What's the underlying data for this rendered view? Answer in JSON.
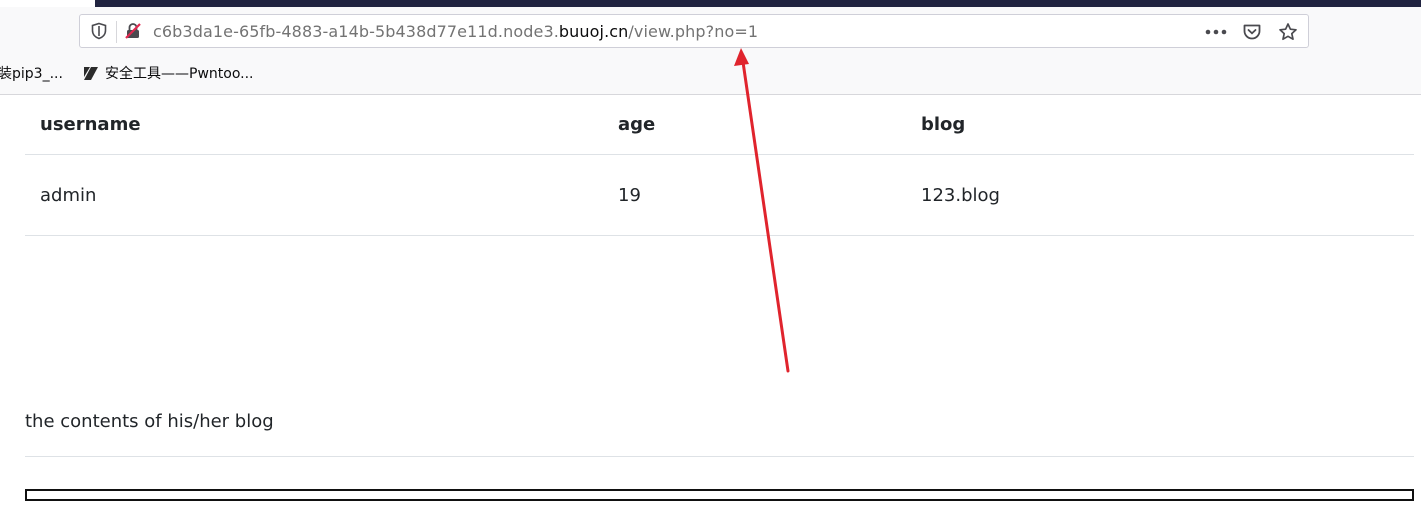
{
  "browser": {
    "url": {
      "prefix": "c6b3da1e-65fb-4883-a14b-5b438d77e11d.node3.",
      "host": "buuoj.cn",
      "path": "/view.php?no=1"
    },
    "bookmarks": [
      {
        "label": "装pip3_..."
      },
      {
        "label": "安全工具——Pwntoo..."
      }
    ],
    "accent_color": "#202340"
  },
  "table": {
    "headers": [
      "username",
      "age",
      "blog"
    ],
    "rows": [
      [
        "admin",
        "19",
        "123.blog"
      ]
    ]
  },
  "blog": {
    "contents_label": "the contents of his/her blog"
  },
  "annotation": {
    "arrow_color": "#e0242d"
  }
}
